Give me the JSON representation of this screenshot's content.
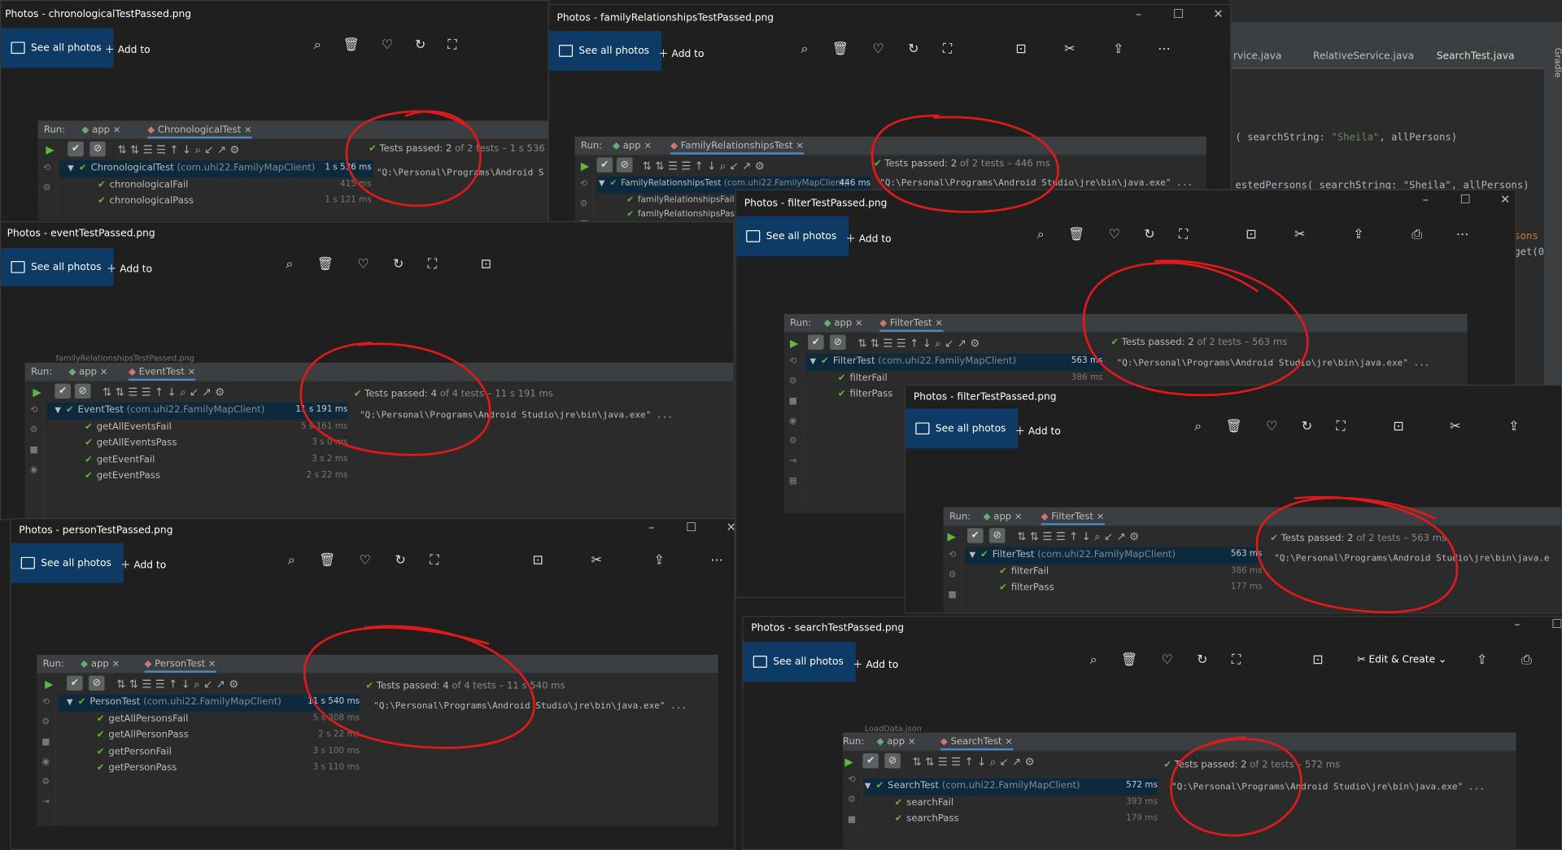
{
  "ide": {
    "tabs": [
      "rvice.java",
      "RelativeService.java",
      "SearchTest.java"
    ],
    "code_line1_prefix": "( searchString: ",
    "code_line1_str": "\"Sheila\"",
    "code_line1_suffix": ", allPersons)",
    "code_line2": "estedPersons( searchString: \"Sheila\", allPersons)",
    "code_line3": "sons",
    "code_line4": "get(0",
    "side_label": "Gradle"
  },
  "common": {
    "see_all": "See all photos",
    "add_to": "Add to",
    "run_label": "Run:",
    "app_label": "app",
    "edit_create": "Edit & Create"
  },
  "windows": {
    "chronological": {
      "title": "Photos - chronologicalTestPassed.png",
      "config": "ChronologicalTest",
      "status_bold": "Tests passed: 2",
      "status_dim": "of 2 tests – 1 s 536 ms",
      "cmd": "\"Q:\\Personal\\Programs\\Android S",
      "rows": [
        {
          "name": "ChronologicalTest",
          "pkg": "(com.uhi22.FamilyMapClient)",
          "time": "1 s 536 ms"
        },
        {
          "name": "chronologicalFail",
          "time": "415 ms"
        },
        {
          "name": "chronologicalPass",
          "time": "1 s 121 ms"
        }
      ]
    },
    "family": {
      "title": "Photos - familyRelationshipsTestPassed.png",
      "config": "FamilyRelationshipsTest",
      "status_bold": "Tests passed: 2",
      "status_dim": "of 2 tests – 446 ms",
      "cmd": "\"Q:\\Personal\\Programs\\Android Studio\\jre\\bin\\java.exe\" ...",
      "rows": [
        {
          "name": "FamilyRelationshipsTest",
          "pkg": "(com.uhi22.FamilyMapClient)",
          "time": "446 ms"
        },
        {
          "name": "familyRelationshipsFail",
          "time": ""
        },
        {
          "name": "familyRelationshipsPass",
          "time": ""
        }
      ]
    },
    "filter1": {
      "title": "Photos - filterTestPassed.png",
      "config": "FilterTest",
      "status_bold": "Tests passed: 2",
      "status_dim": "of 2 tests – 563 ms",
      "cmd": "\"Q:\\Personal\\Programs\\Android Studio\\jre\\bin\\java.exe\" ...",
      "rows": [
        {
          "name": "FilterTest",
          "pkg": "(com.uhi22.FamilyMapClient)",
          "time": "563 ms"
        },
        {
          "name": "filterFail",
          "time": "386 ms"
        },
        {
          "name": "filterPass",
          "time": ""
        }
      ]
    },
    "event": {
      "title": "Photos - eventTestPassed.png",
      "config": "EventTest",
      "status_bold": "Tests passed: 4",
      "status_dim": "of 4 tests – 11 s 191 ms",
      "cmd": "\"Q:\\Personal\\Programs\\Android Studio\\jre\\bin\\java.exe\" ...",
      "peek": "familyRelationshipsTestPassed.png",
      "rows": [
        {
          "name": "EventTest",
          "pkg": "(com.uhi22.FamilyMapClient)",
          "time": "11 s 191 ms"
        },
        {
          "name": "getAllEventsFail",
          "time": "5 s 161 ms"
        },
        {
          "name": "getAllEventsPass",
          "time": "3 s 0 ms"
        },
        {
          "name": "getEventFail",
          "time": "3 s 2 ms"
        },
        {
          "name": "getEventPass",
          "time": "2 s 22 ms"
        }
      ]
    },
    "filter2": {
      "title": "Photos - filterTestPassed.png",
      "config": "FilterTest",
      "status_bold": "Tests passed: 2",
      "status_dim": "of 2 tests – 563 ms",
      "cmd": "\"Q:\\Personal\\Programs\\Android Studio\\jre\\bin\\java.e",
      "rows": [
        {
          "name": "FilterTest",
          "pkg": "(com.uhi22.FamilyMapClient)",
          "time": "563 ms"
        },
        {
          "name": "filterFail",
          "time": "386 ms"
        },
        {
          "name": "filterPass",
          "time": "177 ms"
        }
      ]
    },
    "person": {
      "title": "Photos - personTestPassed.png",
      "config": "PersonTest",
      "status_bold": "Tests passed: 4",
      "status_dim": "of 4 tests – 11 s 540 ms",
      "cmd": "\"Q:\\Personal\\Programs\\Android Studio\\jre\\bin\\java.exe\" ...",
      "rows": [
        {
          "name": "PersonTest",
          "pkg": "(com.uhi22.FamilyMapClient)",
          "time": "11 s 540 ms"
        },
        {
          "name": "getAllPersonsFail",
          "time": "5 s 308 ms"
        },
        {
          "name": "getAllPersonPass",
          "time": "2 s 22 ms"
        },
        {
          "name": "getPersonFail",
          "time": "3 s 100 ms"
        },
        {
          "name": "getPersonPass",
          "time": "3 s 110 ms"
        }
      ]
    },
    "search": {
      "title": "Photos - searchTestPassed.png",
      "config": "SearchTest",
      "status_bold": "Tests passed: 2",
      "status_dim": "of 2 tests – 572 ms",
      "cmd": "\"Q:\\Personal\\Programs\\Android Studio\\jre\\bin\\java.exe\" ...",
      "peek": "LoadData.json",
      "rows": [
        {
          "name": "SearchTest",
          "pkg": "(com.uhi22.FamilyMapClient)",
          "time": "572 ms"
        },
        {
          "name": "searchFail",
          "time": "393 ms"
        },
        {
          "name": "searchPass",
          "time": "179 ms"
        }
      ]
    }
  },
  "colors": {
    "accent": "#0e3a66",
    "pass": "#5fb83b",
    "annotation": "#e0191c"
  }
}
